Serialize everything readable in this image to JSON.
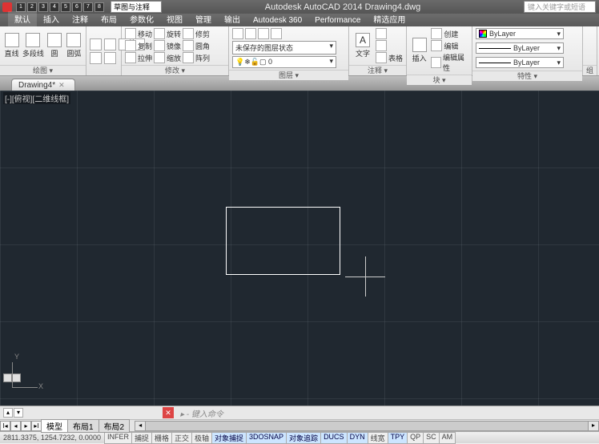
{
  "title": "Autodesk AutoCAD 2014   Drawing4.dwg",
  "search_placeholder": "键入关键字或短语",
  "workspace": "草图与注释",
  "qat_labels": [
    "1",
    "2",
    "3",
    "4",
    "5",
    "6",
    "7",
    "8"
  ],
  "menu_tabs": [
    "默认",
    "插入",
    "注释",
    "布局",
    "参数化",
    "视图",
    "管理",
    "输出",
    "Autodesk 360",
    "Performance",
    "精选应用"
  ],
  "ribbon": {
    "draw": {
      "title": "绘图",
      "btns": [
        "直线",
        "多段线",
        "圆",
        "圆弧"
      ]
    },
    "modify": {
      "title": "修改",
      "rows": [
        [
          "移动",
          "旋转",
          "修剪"
        ],
        [
          "复制",
          "镜像",
          "圆角"
        ],
        [
          "拉伸",
          "缩放",
          "阵列"
        ]
      ]
    },
    "layer": {
      "title": "图层",
      "state": "未保存的图层状态",
      "zero": "0"
    },
    "anno": {
      "title": "注释",
      "a": "A",
      "text": "文字",
      "table": "表格"
    },
    "block": {
      "title": "块",
      "insert": "插入",
      "rows": [
        "创建",
        "编辑",
        "编辑属性"
      ]
    },
    "props": {
      "title": "特性",
      "bylayer": "ByLayer"
    },
    "group": {
      "title": "组"
    }
  },
  "file_tab": "Drawing4*",
  "viewport_label": "[-][俯视][二维线框]",
  "ucs": {
    "x": "X",
    "y": "Y"
  },
  "cmd_prompt": "▸ - 键入命令",
  "layout_tabs": {
    "model": "模型",
    "l1": "布局1",
    "l2": "布局2"
  },
  "nav": [
    "I◂",
    "◂",
    "▸",
    "▸I"
  ],
  "coords": "2811.3375, 1254.7232, 0.0000",
  "status_toggles": [
    {
      "t": "INFER",
      "on": false
    },
    {
      "t": "捕捉",
      "on": false
    },
    {
      "t": "栅格",
      "on": false
    },
    {
      "t": "正交",
      "on": false
    },
    {
      "t": "极轴",
      "on": false
    },
    {
      "t": "对象捕捉",
      "on": true
    },
    {
      "t": "3DOSNAP",
      "on": true
    },
    {
      "t": "对象追踪",
      "on": true
    },
    {
      "t": "DUCS",
      "on": true
    },
    {
      "t": "DYN",
      "on": true
    },
    {
      "t": "线宽",
      "on": false
    },
    {
      "t": "TPY",
      "on": true
    },
    {
      "t": "QP",
      "on": false
    },
    {
      "t": "SC",
      "on": false
    },
    {
      "t": "AM",
      "on": false
    }
  ]
}
